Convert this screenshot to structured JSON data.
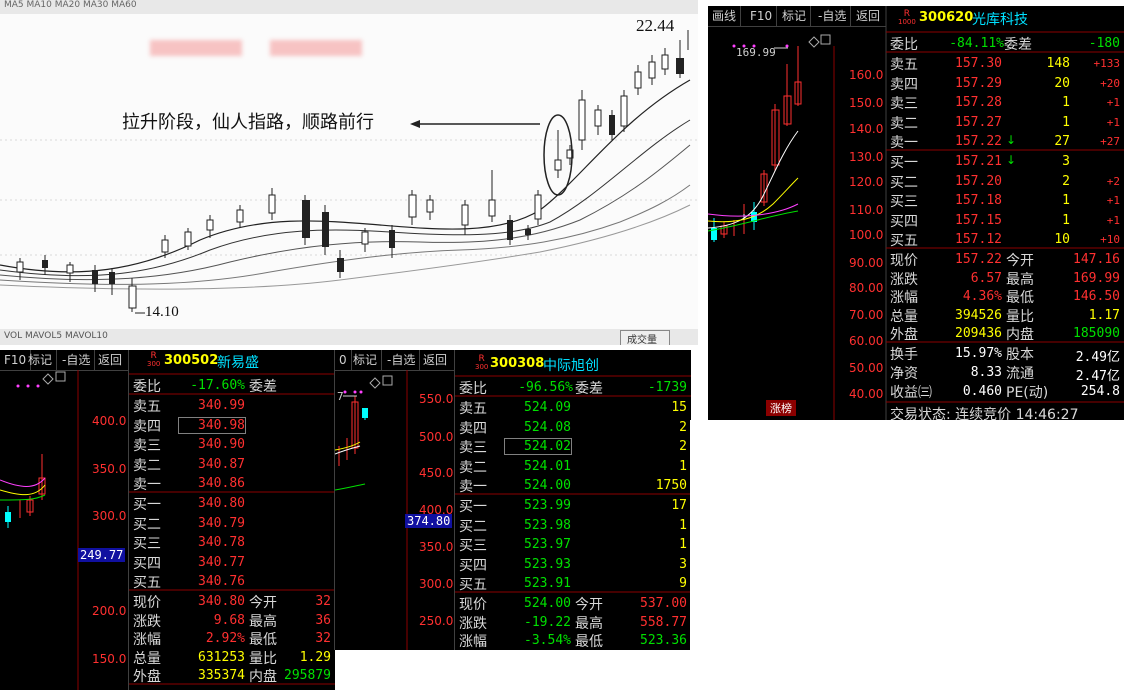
{
  "scan": {
    "top_caption": "MA5 MA10 MA20 MA30 MA60",
    "caption": "拉升阶段，仙人指路，顺路前行",
    "high_label": "22.44",
    "low_label": "14.10",
    "bottom_caption": "VOL MAVOL5 MAVOL10",
    "bottom_right": "成交量"
  },
  "toolbar_labels": {
    "draw": "画线",
    "f10": "F10",
    "mark": "标记",
    "watch": "-自选",
    "back": "返回"
  },
  "panel_300620": {
    "code": "300620",
    "name": "光库科技",
    "badge_top": "R",
    "badge_bottom": "1000",
    "chart_high": "169.99",
    "axis": [
      "160.0",
      "150.0",
      "140.0",
      "130.0",
      "120.0",
      "110.0",
      "100.0",
      "90.00",
      "80.00",
      "70.00",
      "60.00",
      "50.00",
      "40.00"
    ],
    "weibi": {
      "label": "委比",
      "value": "-84.11%",
      "label2": "委差",
      "value2": "-180"
    },
    "sells": [
      {
        "label": "卖五",
        "price": "157.30",
        "vol": "148",
        "chg": "+133"
      },
      {
        "label": "卖四",
        "price": "157.29",
        "vol": "20",
        "chg": "+20"
      },
      {
        "label": "卖三",
        "price": "157.28",
        "vol": "1",
        "chg": "+1"
      },
      {
        "label": "卖二",
        "price": "157.27",
        "vol": "1",
        "chg": "+1"
      },
      {
        "label": "卖一",
        "price": "157.22",
        "vol": "27",
        "chg": "+27"
      }
    ],
    "buys": [
      {
        "label": "买一",
        "price": "157.21",
        "vol": "3",
        "chg": ""
      },
      {
        "label": "买二",
        "price": "157.20",
        "vol": "2",
        "chg": "+2"
      },
      {
        "label": "买三",
        "price": "157.18",
        "vol": "1",
        "chg": "+1"
      },
      {
        "label": "买四",
        "price": "157.15",
        "vol": "1",
        "chg": "+1"
      },
      {
        "label": "买五",
        "price": "157.12",
        "vol": "10",
        "chg": "+10"
      }
    ],
    "stats": [
      {
        "l1": "现价",
        "v1": "157.22",
        "l2": "今开",
        "v2": "147.16"
      },
      {
        "l1": "涨跌",
        "v1": "6.57",
        "l2": "最高",
        "v2": "169.99"
      },
      {
        "l1": "涨幅",
        "v1": "4.36%",
        "l2": "最低",
        "v2": "146.50"
      },
      {
        "l1": "总量",
        "v1": "394526",
        "l2": "量比",
        "v2": "1.17"
      },
      {
        "l1": "外盘",
        "v1": "209436",
        "l2": "内盘",
        "v2": "185090"
      }
    ],
    "stats2": [
      {
        "l1": "换手",
        "v1": "15.97%",
        "l2": "股本",
        "v2": "2.49亿"
      },
      {
        "l1": "净资",
        "v1": "8.33",
        "l2": "流通",
        "v2": "2.47亿"
      },
      {
        "l1": "收益㈢",
        "v1": "0.460",
        "l2": "PE(动)",
        "v2": "254.8"
      }
    ],
    "trade_status": "交易状态: 连续竞价 14:46:27",
    "zhangbang": "涨榜"
  },
  "panel_300502": {
    "code": "300502",
    "name": "新易盛",
    "badge_top": "R",
    "badge_bottom": "300",
    "axis": [
      "400.0",
      "350.0",
      "300.0",
      "250.0",
      "200.0",
      "150.0"
    ],
    "cursor_price": "249.77",
    "weibi": {
      "label": "委比",
      "value": "-17.60%",
      "label2": "委差"
    },
    "sells": [
      {
        "label": "卖五",
        "price": "340.99"
      },
      {
        "label": "卖四",
        "price": "340.98"
      },
      {
        "label": "卖三",
        "price": "340.90"
      },
      {
        "label": "卖二",
        "price": "340.87"
      },
      {
        "label": "卖一",
        "price": "340.86"
      }
    ],
    "buys": [
      {
        "label": "买一",
        "price": "340.80"
      },
      {
        "label": "买二",
        "price": "340.79"
      },
      {
        "label": "买三",
        "price": "340.78"
      },
      {
        "label": "买四",
        "price": "340.77"
      },
      {
        "label": "买五",
        "price": "340.76"
      }
    ],
    "stats": [
      {
        "l1": "现价",
        "v1": "340.80",
        "l2": "今开",
        "v2": "32"
      },
      {
        "l1": "涨跌",
        "v1": "9.68",
        "l2": "最高",
        "v2": "36"
      },
      {
        "l1": "涨幅",
        "v1": "2.92%",
        "l2": "最低",
        "v2": "32"
      },
      {
        "l1": "总量",
        "v1": "631253",
        "l2": "量比",
        "v2": "1.29"
      },
      {
        "l1": "外盘",
        "v1": "335374",
        "l2": "内盘",
        "v2": "295879"
      }
    ]
  },
  "panel_mid": {
    "axis": [
      "550.0",
      "500.0",
      "450.0",
      "400.0",
      "350.0",
      "300.0",
      "250.0"
    ],
    "cursor_price": "374.80",
    "seven": "7"
  },
  "panel_300308": {
    "code": "300308",
    "name": "中际旭创",
    "badge_top": "R",
    "badge_bottom": "300",
    "weibi": {
      "label": "委比",
      "value": "-96.56%",
      "label2": "委差",
      "value2": "-1739"
    },
    "sells": [
      {
        "label": "卖五",
        "price": "524.09",
        "vol": "15"
      },
      {
        "label": "卖四",
        "price": "524.08",
        "vol": "2"
      },
      {
        "label": "卖三",
        "price": "524.02",
        "vol": "2"
      },
      {
        "label": "卖二",
        "price": "524.01",
        "vol": "1"
      },
      {
        "label": "卖一",
        "price": "524.00",
        "vol": "1750"
      }
    ],
    "buys": [
      {
        "label": "买一",
        "price": "523.99",
        "vol": "17"
      },
      {
        "label": "买二",
        "price": "523.98",
        "vol": "1"
      },
      {
        "label": "买三",
        "price": "523.97",
        "vol": "1"
      },
      {
        "label": "买四",
        "price": "523.93",
        "vol": "3"
      },
      {
        "label": "买五",
        "price": "523.91",
        "vol": "9"
      }
    ],
    "stats": [
      {
        "l1": "现价",
        "v1": "524.00",
        "l2": "今开",
        "v2": "537.00"
      },
      {
        "l1": "涨跌",
        "v1": "-19.22",
        "l2": "最高",
        "v2": "558.77"
      },
      {
        "l1": "涨幅",
        "v1": "-3.54%",
        "l2": "最低",
        "v2": "523.36"
      }
    ]
  },
  "left_partial": {
    "axis": [
      "400.0",
      "350.0",
      "300.0",
      "250.0",
      "200.0",
      "150.0"
    ],
    "cursor_price": "249.77"
  },
  "colors": {
    "up": "#ff3030",
    "down": "#00e000",
    "bg": "#000000",
    "grid": "#8b0000"
  }
}
